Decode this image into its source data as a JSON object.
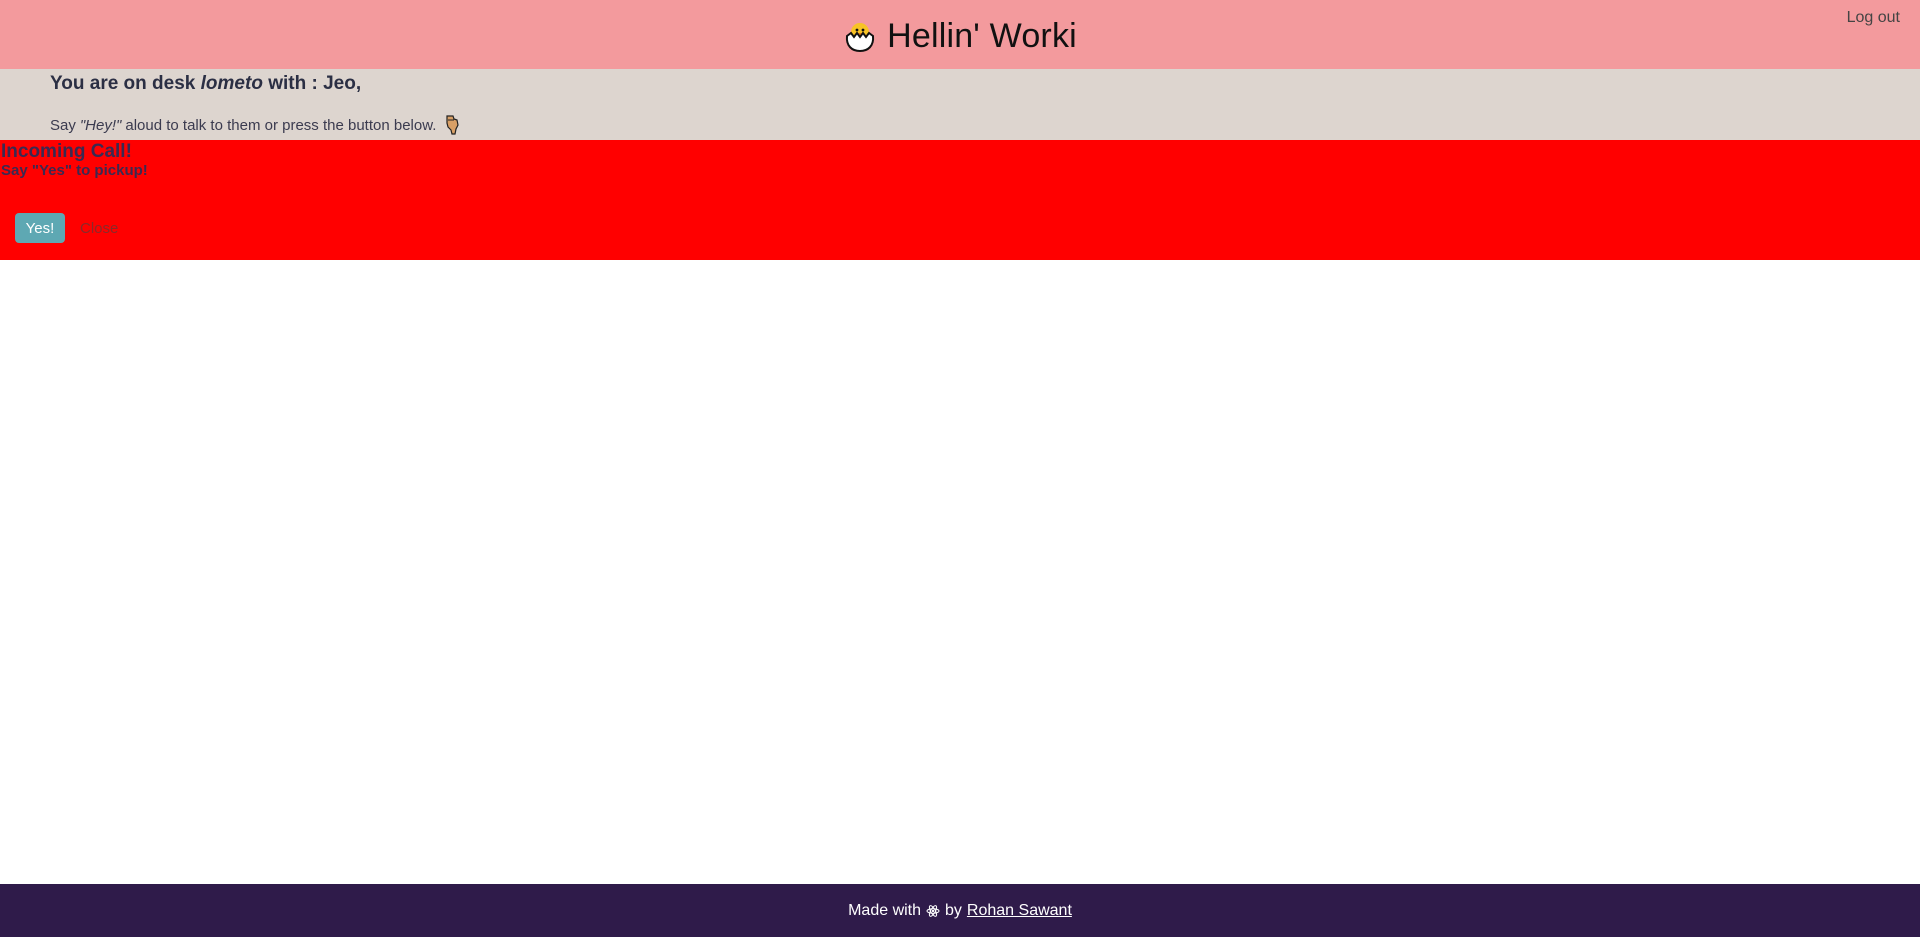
{
  "header": {
    "app_title": "Hellin' Worki",
    "logo_icon": "hatching-chick-icon",
    "logout_label": "Log out"
  },
  "desk": {
    "heading_prefix": "You are on desk",
    "desk_name": "lometo",
    "heading_suffix": "with : Jeo,",
    "hint_prefix": "Say",
    "hint_phrase": "\"Hey!\"",
    "hint_suffix": "aloud to talk to them or press the button below.",
    "hint_icon": "pointing-down-hand-icon"
  },
  "call": {
    "title": "Incoming Call!",
    "subtitle": "Say \"Yes\" to pickup!",
    "yes_label": "Yes!",
    "close_label": "Close"
  },
  "footer": {
    "prefix": "Made with",
    "icon": "atom-icon",
    "by": "by",
    "author": "Rohan Sawant"
  },
  "colors": {
    "header_bg": "#f39a9d",
    "desk_bg": "#ddd5cf",
    "call_bg": "#ff0000",
    "yes_button_bg": "#5ea8b3",
    "footer_bg": "#2f1b4a"
  }
}
